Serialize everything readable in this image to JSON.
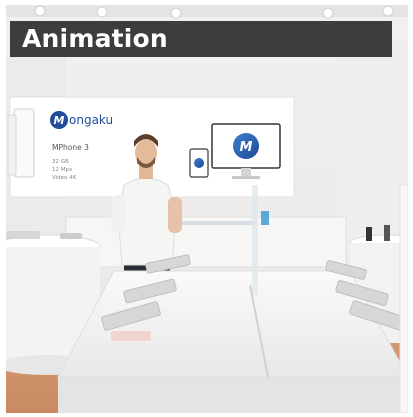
{
  "banner": {
    "title": "Animation"
  },
  "wall_sign": {
    "brand": "ongaku",
    "brand_initial": "M",
    "product": "MPhone 3",
    "specs": [
      "32 GB",
      "12 Mpx",
      "Video 4K"
    ]
  },
  "colors": {
    "banner_bg": "#3d3d3e",
    "brand_blue": "#1e4d9a"
  }
}
